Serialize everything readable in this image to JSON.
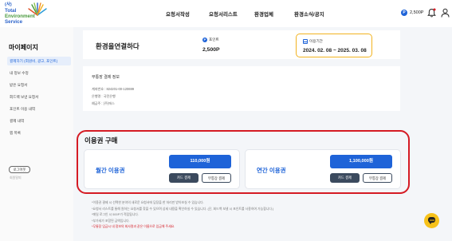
{
  "logo": {
    "line1": "(사)",
    "line2": "Total",
    "line3": "Environment",
    "line4": "Service"
  },
  "nav": [
    "요청서작성",
    "요청서리스트",
    "환경업체",
    "환경소식/공지"
  ],
  "header": {
    "points_badge_icon": "P",
    "points": "2,500P",
    "bell_icon": "bell-icon",
    "user_icon": "user-icon"
  },
  "sidebar": {
    "title": "마이페이지",
    "items": [
      {
        "label": "결제하기 (회원비, 광고, 포인트)",
        "active": true
      },
      {
        "label": "내 정보 수정",
        "active": false
      },
      {
        "label": "받은 요청서",
        "active": false
      },
      {
        "label": "회드백 보낸 요청서",
        "active": false
      },
      {
        "label": "포인트 이용 내역",
        "active": false
      },
      {
        "label": "결제 내역",
        "active": false
      },
      {
        "label": "찜 목록",
        "active": false
      }
    ],
    "logout": "로그아웃",
    "withdraw": "회원탈퇴"
  },
  "summary": {
    "title": "환경을연결하다",
    "point_icon": "P",
    "point_label": "포인트",
    "point_value": "2,500P",
    "period_label": "이용기간",
    "period_value": "2024. 02. 08 ~ 2025. 03. 08"
  },
  "account": {
    "title": "무통장 결제 정보",
    "lines": [
      "계좌번호 : 824201-00-120699",
      "은행명 : 국민은행",
      "예금주 : (주)에스"
    ]
  },
  "pass": {
    "title": "이용권 구매",
    "monthly": {
      "name": "월간 이용권",
      "price": "110,000원",
      "card_btn": "카드 결제",
      "bank_btn": "무통장 결제"
    },
    "yearly": {
      "name": "연간 이용권",
      "price": "1,100,000원",
      "card_btn": "카드 결제",
      "bank_btn": "무통장 결제"
    }
  },
  "notes": [
    {
      "text": "*이용권 결제 시 선택한 분야의 새로운 요청서에 답장을 한 처리만 받아보실 수 있습니다.",
      "red": false
    },
    {
      "text": "*요청서 리스트를 통해 원하는 요청서를 찾을 수 있으며 상세 내용을 확인하실 수 있습니다. (단, 회드백 보낼 시 포인트를 사용하여 가능합니다.)",
      "red": false
    },
    {
      "text": "*매일 로그인 시 500P가 적립됩니다.",
      "red": false
    },
    {
      "text": "*부가세가 포함된 금액입니다.",
      "red": false
    },
    {
      "text": "*무통장 입금시 내 정보의 회사명과 같은 이름으로 입금해 주세요.",
      "red": true
    }
  ],
  "colors": {
    "accent": "#1e63d8",
    "period_border": "#f2b320",
    "highlight_border": "#d51b24",
    "chat_button": "#f7c21b"
  }
}
